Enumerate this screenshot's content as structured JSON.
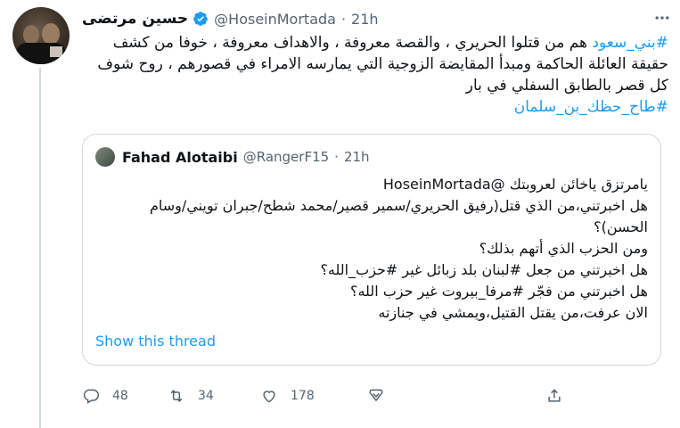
{
  "tweet": {
    "author_name": "حسين مرتضى",
    "author_handle": "@HoseinMortada",
    "separator": "·",
    "time": "21h",
    "hashtag_start": "#بني_سعود",
    "text_main": " هم من قتلوا الحريري ، والقصة معروفة ، والاهداف معروفة ، خوفا من كشف حقيقة العائلة الحاكمة ومبدأ المقايضة الزوجية التي يمارسه الامراء في قصورهم ، روح شوف كل قصر بالطابق السفلي في بار",
    "hashtag_end": "#طاح_حظك_بن_سلمان"
  },
  "quote": {
    "author_name": "Fahad Alotaibi",
    "author_handle": "@RangerF15",
    "separator": "·",
    "time": "21h",
    "lines": [
      "يامرتزق ياخائن لعروبتك @HoseinMortada",
      "هل اخبرتني،من الذي قتل(رفيق الحريري/سمير قصير/محمد شطح/جبران تويني/وسام الحسن)؟",
      "ومن الحزب الذي أتهم بذلك؟",
      "هل اخبرتني من جعل #لبنان بلد زبائل غير #حزب_الله؟",
      "هل اخبرتني من فجّر #مرفا_بيروت غير حزب الله؟",
      "الان عرفت،من يقتل القتيل،ويمشي في جنازته"
    ],
    "show_thread": "Show this thread"
  },
  "actions": {
    "reply_count": "48",
    "retweet_count": "34",
    "like_count": "178"
  },
  "colors": {
    "accent": "#1d9bf0",
    "muted": "#536471",
    "border": "#cfd9de"
  },
  "icons": [
    "verified-badge-icon",
    "more-icon",
    "reply-icon",
    "retweet-icon",
    "like-icon",
    "bookmark-icon",
    "share-icon"
  ]
}
